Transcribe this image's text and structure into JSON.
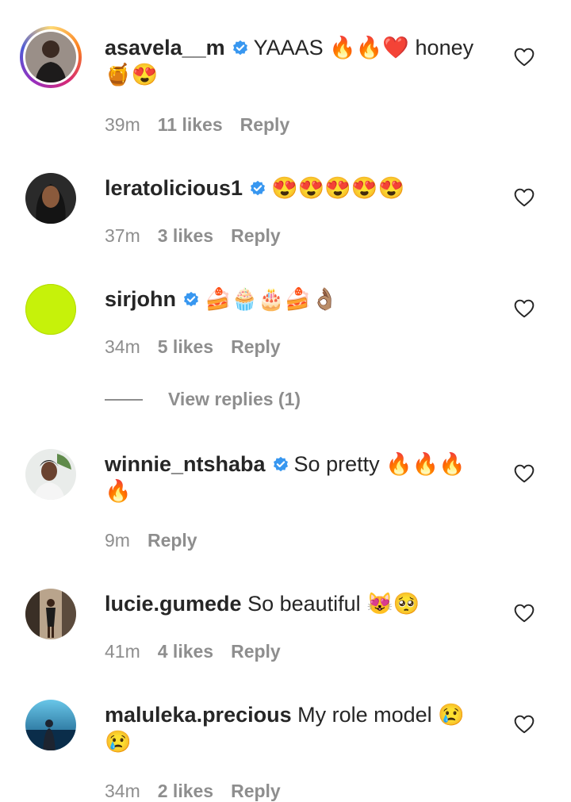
{
  "comments": [
    {
      "username": "asavela__m",
      "verified": true,
      "text": "YAAAS 🔥🔥❤️ honey 🍯😍",
      "time": "39m",
      "likes": "11 likes",
      "reply": "Reply"
    },
    {
      "username": "leratolicious1",
      "verified": true,
      "text": "😍😍😍😍😍",
      "time": "37m",
      "likes": "3 likes",
      "reply": "Reply"
    },
    {
      "username": "sirjohn",
      "verified": true,
      "text": "🍰🧁🎂🍰👌🏽",
      "time": "34m",
      "likes": "5 likes",
      "reply": "Reply"
    },
    {
      "username": "winnie_ntshaba",
      "verified": true,
      "text": "So pretty 🔥🔥🔥🔥",
      "time": "9m",
      "likes": "",
      "reply": "Reply"
    },
    {
      "username": "lucie.gumede",
      "verified": false,
      "text": "So beautiful 😻🥺",
      "time": "41m",
      "likes": "4 likes",
      "reply": "Reply"
    },
    {
      "username": "maluleka.precious",
      "verified": false,
      "text": "My role model 😢😢",
      "time": "34m",
      "likes": "2 likes",
      "reply": "Reply"
    }
  ],
  "view_replies": "View replies (1)",
  "colors": {
    "text": "#262626",
    "secondary": "#8e8e8e",
    "verified_blue": "#3897f0",
    "sirjohn_avatar": "#c6f20a"
  },
  "icons": {
    "verified": "verified-badge-icon",
    "like": "heart-outline-icon"
  }
}
